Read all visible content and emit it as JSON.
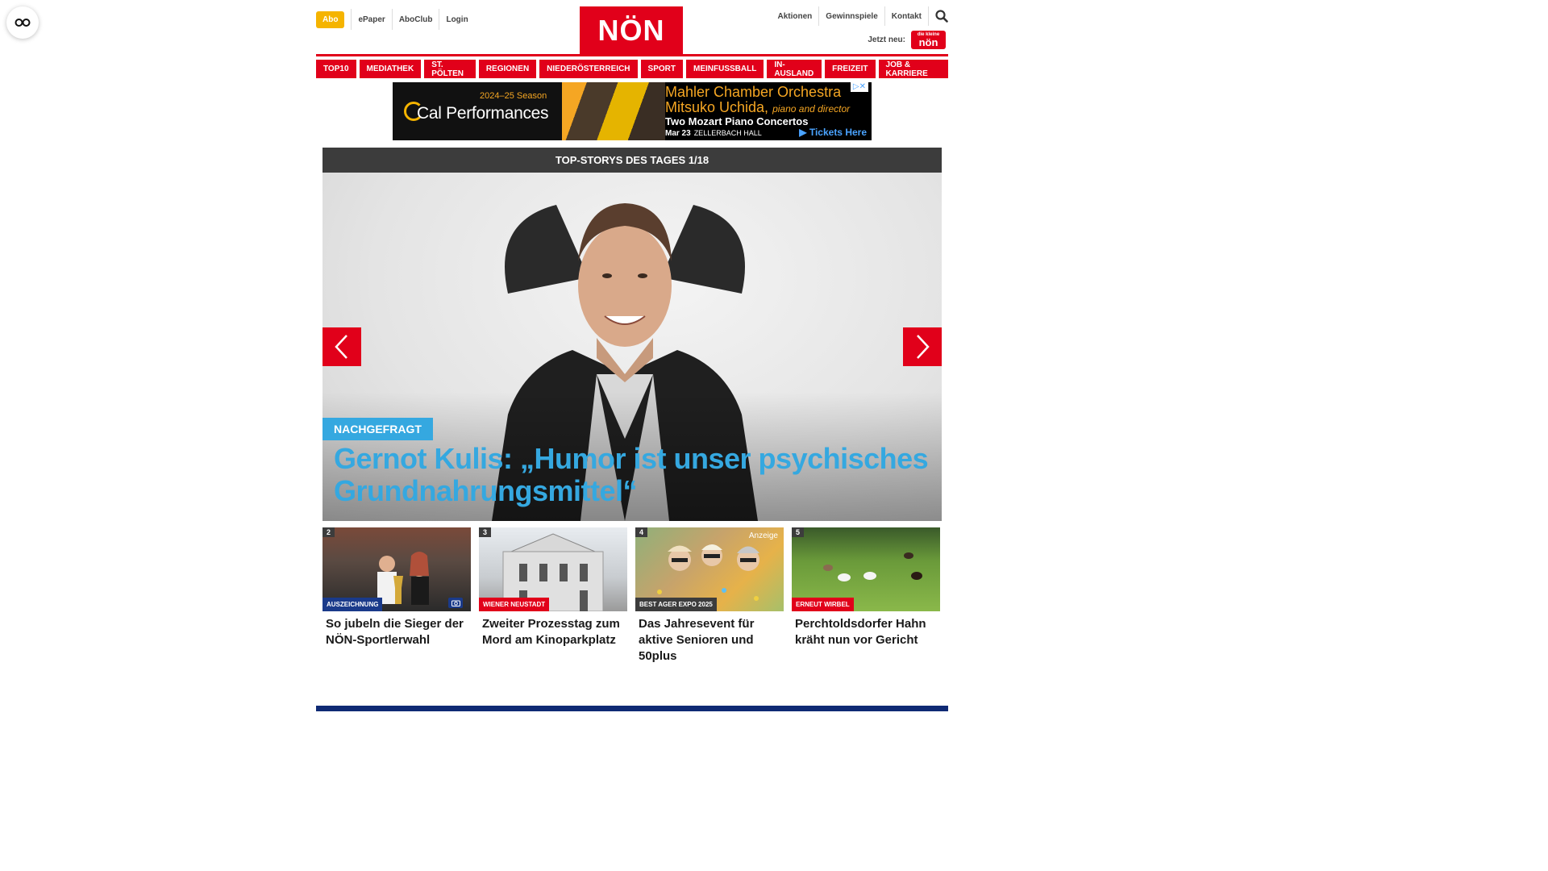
{
  "header": {
    "abo": "Abo",
    "left_links": [
      "ePaper",
      "AboClub",
      "Login"
    ],
    "logo": "NÖN",
    "right_links": [
      "Aktionen",
      "Gewinnspiele",
      "Kontakt"
    ],
    "jetzt_neu": "Jetzt neu:",
    "badge_top": "die kleine",
    "badge_bottom": "nön"
  },
  "nav": [
    "TOP10",
    "MEDIATHEK",
    "ST. PÖLTEN",
    "REGIONEN",
    "NIEDERÖSTERREICH",
    "SPORT",
    "MEINFUSSBALL",
    "IN-AUSLAND",
    "FREIZEIT",
    "JOB & KARRIERE"
  ],
  "ad": {
    "season": "2024–25 Season",
    "brand": "Cal Performances",
    "line1": "Mahler Chamber Orchestra",
    "line2": "Mitsuko Uchida,",
    "line2_role": "piano and director",
    "line3": "Two Mozart Piano Concertos",
    "date": "Mar 23",
    "venue": "ZELLERBACH HALL",
    "cta": "▶ Tickets Here",
    "adchoice": "▷✕"
  },
  "top_stories": {
    "header": "TOP-STORYS DES TAGES 1/18",
    "hero": {
      "kicker": "NACHGEFRAGT",
      "headline": "Gernot Kulis: „Humor ist unser psychisches Grundnahrungsmittel“"
    },
    "cards": [
      {
        "num": "2",
        "tag": "AUSZEICHNUNG",
        "tag_color": "#1a3a8a",
        "title": "So jubeln die Sieger der NÖN-Sportlerwahl",
        "has_camera": true,
        "anzeige": ""
      },
      {
        "num": "3",
        "tag": "WIENER NEUSTADT",
        "tag_color": "#e1001a",
        "title": "Zweiter Prozesstag zum Mord am Kinoparkplatz",
        "has_camera": false,
        "anzeige": ""
      },
      {
        "num": "4",
        "tag": "BEST AGER EXPO 2025",
        "tag_color": "#3c3c3c",
        "title": "Das Jahresevent für aktive Senioren und 50plus",
        "has_camera": false,
        "anzeige": "Anzeige"
      },
      {
        "num": "5",
        "tag": "ERNEUT WIRBEL",
        "tag_color": "#e1001a",
        "title": "Perchtoldsdorfer Hahn kräht nun vor Gericht",
        "has_camera": false,
        "anzeige": ""
      }
    ]
  },
  "colors": {
    "brand_red": "#e1001a",
    "accent_blue": "#35a8e0",
    "abo_yellow": "#f5b400",
    "footer_navy": "#0f2a74"
  }
}
